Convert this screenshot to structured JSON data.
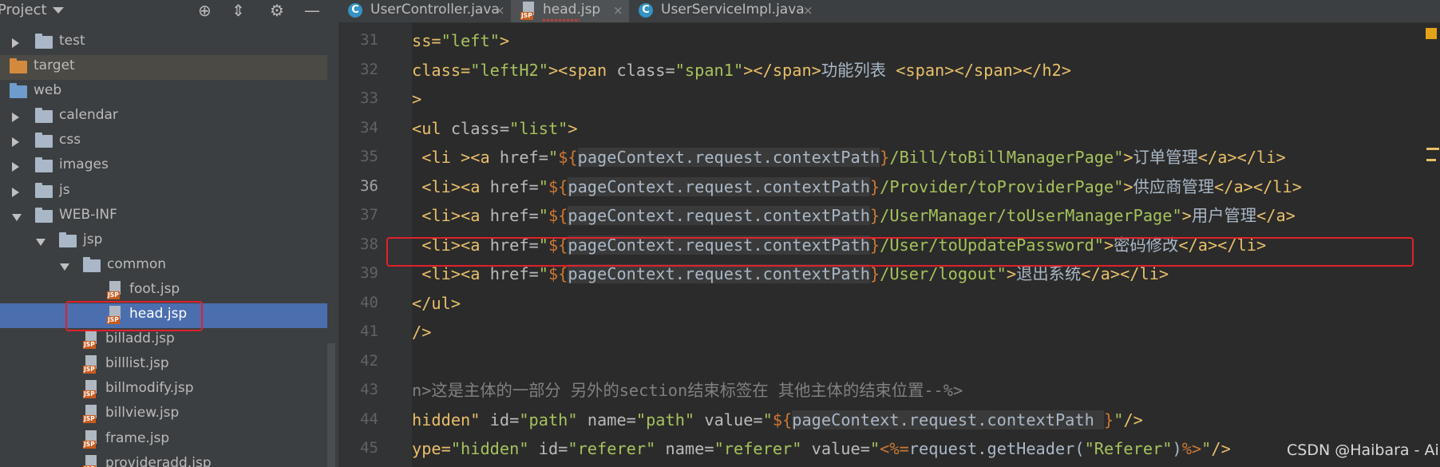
{
  "project_panel": {
    "title": "Project",
    "header_icons": [
      "crosshair-icon",
      "collapse-icon",
      "gear-icon",
      "minimize-icon"
    ],
    "tree": [
      {
        "label": "test",
        "kind": "folder",
        "level": 1,
        "expander": "collapsed"
      },
      {
        "label": "target",
        "kind": "folder-orange",
        "level": 0,
        "expander": "none",
        "state": "hover"
      },
      {
        "label": "web",
        "kind": "folder-web",
        "level": 0,
        "expander": "none"
      },
      {
        "label": "calendar",
        "kind": "folder",
        "level": 1,
        "expander": "collapsed"
      },
      {
        "label": "css",
        "kind": "folder",
        "level": 1,
        "expander": "collapsed"
      },
      {
        "label": "images",
        "kind": "folder",
        "level": 1,
        "expander": "collapsed"
      },
      {
        "label": "js",
        "kind": "folder",
        "level": 1,
        "expander": "collapsed"
      },
      {
        "label": "WEB-INF",
        "kind": "folder",
        "level": 1,
        "expander": "expanded"
      },
      {
        "label": "jsp",
        "kind": "folder",
        "level": 2,
        "expander": "expanded"
      },
      {
        "label": "common",
        "kind": "folder",
        "level": 3,
        "expander": "expanded"
      },
      {
        "label": "foot.jsp",
        "kind": "jsp",
        "level": 4,
        "expander": "none"
      },
      {
        "label": "head.jsp",
        "kind": "jsp",
        "level": 4,
        "expander": "none",
        "state": "selected"
      },
      {
        "label": "billadd.jsp",
        "kind": "jsp",
        "level": 3,
        "expander": "none"
      },
      {
        "label": "billlist.jsp",
        "kind": "jsp",
        "level": 3,
        "expander": "none"
      },
      {
        "label": "billmodify.jsp",
        "kind": "jsp",
        "level": 3,
        "expander": "none"
      },
      {
        "label": "billview.jsp",
        "kind": "jsp",
        "level": 3,
        "expander": "none"
      },
      {
        "label": "frame.jsp",
        "kind": "jsp",
        "level": 3,
        "expander": "none"
      },
      {
        "label": "provideradd.jsp",
        "kind": "jsp",
        "level": 3,
        "expander": "none"
      }
    ]
  },
  "tabs": [
    {
      "label": "UserController.java",
      "icon": "class-icon",
      "active": false
    },
    {
      "label": "head.jsp",
      "icon": "jsp-icon",
      "active": true
    },
    {
      "label": "UserServiceImpl.java",
      "icon": "class-icon",
      "active": false
    }
  ],
  "close_glyph": "×",
  "icon_glyphs": {
    "class": "C",
    "jsp": "JSP"
  },
  "editor": {
    "current_line": 36,
    "highlighted_line": 38,
    "lines": [
      {
        "n": 31,
        "tokens": [
          [
            "t",
            "ss="
          ],
          [
            "v",
            "\"left\""
          ],
          [
            "t",
            ">"
          ]
        ]
      },
      {
        "n": 32,
        "tokens": [
          [
            "t",
            "class="
          ],
          [
            "v",
            "\"leftH2\""
          ],
          [
            "t",
            ">"
          ],
          [
            "t",
            "<span "
          ],
          [
            "a",
            "class="
          ],
          [
            "v",
            "\"span1\""
          ],
          [
            "t",
            "></span>"
          ],
          [
            "p",
            "功能列表 "
          ],
          [
            "t",
            "<span></span></h2>"
          ]
        ]
      },
      {
        "n": 33,
        "tokens": [
          [
            "t",
            ">"
          ]
        ]
      },
      {
        "n": 34,
        "tokens": [
          [
            "t",
            "<ul "
          ],
          [
            "a",
            "class="
          ],
          [
            "v",
            "\"list\""
          ],
          [
            "t",
            ">"
          ]
        ]
      },
      {
        "n": 35,
        "tokens": [
          [
            "t",
            " <li ><a "
          ],
          [
            "a",
            "href="
          ],
          [
            "v",
            "\""
          ],
          [
            "x",
            "${"
          ],
          [
            "e",
            "pageContext.request.contextPath"
          ],
          [
            "x",
            "}"
          ],
          [
            "v",
            "/Bill/toBillManagerPage\""
          ],
          [
            "t",
            ">"
          ],
          [
            "p",
            "订单管理"
          ],
          [
            "t",
            "</a></li>"
          ]
        ]
      },
      {
        "n": 36,
        "tokens": [
          [
            "t",
            " <li><a "
          ],
          [
            "a",
            "href="
          ],
          [
            "v",
            "\""
          ],
          [
            "x",
            "${"
          ],
          [
            "e",
            "pageContext.request.contextPath"
          ],
          [
            "x",
            "}"
          ],
          [
            "v",
            "/Provider/toProviderPage\""
          ],
          [
            "t",
            ">"
          ],
          [
            "p",
            "供应商管理"
          ],
          [
            "t",
            "</a></li>"
          ]
        ]
      },
      {
        "n": 37,
        "tokens": [
          [
            "t",
            " <li><a "
          ],
          [
            "a",
            "href="
          ],
          [
            "v",
            "\""
          ],
          [
            "x",
            "${"
          ],
          [
            "e",
            "pageContext.request.contextPath"
          ],
          [
            "x",
            "}"
          ],
          [
            "v",
            "/UserManager/toUserManagerPage\""
          ],
          [
            "t",
            ">"
          ],
          [
            "p",
            "用户管理"
          ],
          [
            "t",
            "</a>"
          ]
        ]
      },
      {
        "n": 38,
        "tokens": [
          [
            "t",
            " <li><a "
          ],
          [
            "a",
            "href="
          ],
          [
            "v",
            "\""
          ],
          [
            "x",
            "${"
          ],
          [
            "e",
            "pageContext.request.contextPath"
          ],
          [
            "x",
            "}"
          ],
          [
            "v",
            "/User/toUpdatePassword\""
          ],
          [
            "t",
            ">"
          ],
          [
            "p",
            "密码修改"
          ],
          [
            "t",
            "</a></li>"
          ]
        ]
      },
      {
        "n": 39,
        "tokens": [
          [
            "t",
            " <li><a "
          ],
          [
            "a",
            "href="
          ],
          [
            "v",
            "\""
          ],
          [
            "x",
            "${"
          ],
          [
            "e",
            "pageContext.request.contextPath"
          ],
          [
            "x",
            "}"
          ],
          [
            "v",
            "/User/logout\""
          ],
          [
            "t",
            ">"
          ],
          [
            "p",
            "退出系统"
          ],
          [
            "t",
            "</a></li>"
          ]
        ]
      },
      {
        "n": 40,
        "tokens": [
          [
            "t",
            "</ul>"
          ]
        ]
      },
      {
        "n": 41,
        "tokens": [
          [
            "t",
            "/>"
          ]
        ]
      },
      {
        "n": 42,
        "tokens": []
      },
      {
        "n": 43,
        "tokens": [
          [
            "c",
            "n>这是主体的一部分 另外的section结束标签在 其他主体的结束位置--%>"
          ]
        ]
      },
      {
        "n": 44,
        "tokens": [
          [
            "t",
            "hidden\" "
          ],
          [
            "a",
            "id="
          ],
          [
            "v",
            "\"path\" "
          ],
          [
            "a",
            "name="
          ],
          [
            "v",
            "\"path\" "
          ],
          [
            "a",
            "value="
          ],
          [
            "v",
            "\""
          ],
          [
            "x",
            "${"
          ],
          [
            "e",
            "pageContext.request.contextPath "
          ],
          [
            "x",
            "}"
          ],
          [
            "v",
            "\""
          ],
          [
            "t",
            "/>"
          ]
        ]
      },
      {
        "n": 45,
        "tokens": [
          [
            "t",
            "ype="
          ],
          [
            "v",
            "\"hidden\" "
          ],
          [
            "a",
            "id="
          ],
          [
            "v",
            "\"referer\" "
          ],
          [
            "a",
            "name="
          ],
          [
            "v",
            "\"referer\" "
          ],
          [
            "a",
            "value="
          ],
          [
            "v",
            "\""
          ],
          [
            "x",
            "<%="
          ],
          [
            "z",
            "request.getHeader("
          ],
          [
            "v",
            "\"Referer\""
          ],
          [
            "z",
            ")"
          ],
          [
            "x",
            "%>"
          ],
          [
            "v",
            "\""
          ],
          [
            "t",
            "/>"
          ]
        ]
      }
    ]
  },
  "watermark": "CSDN @Haibara - Ai"
}
